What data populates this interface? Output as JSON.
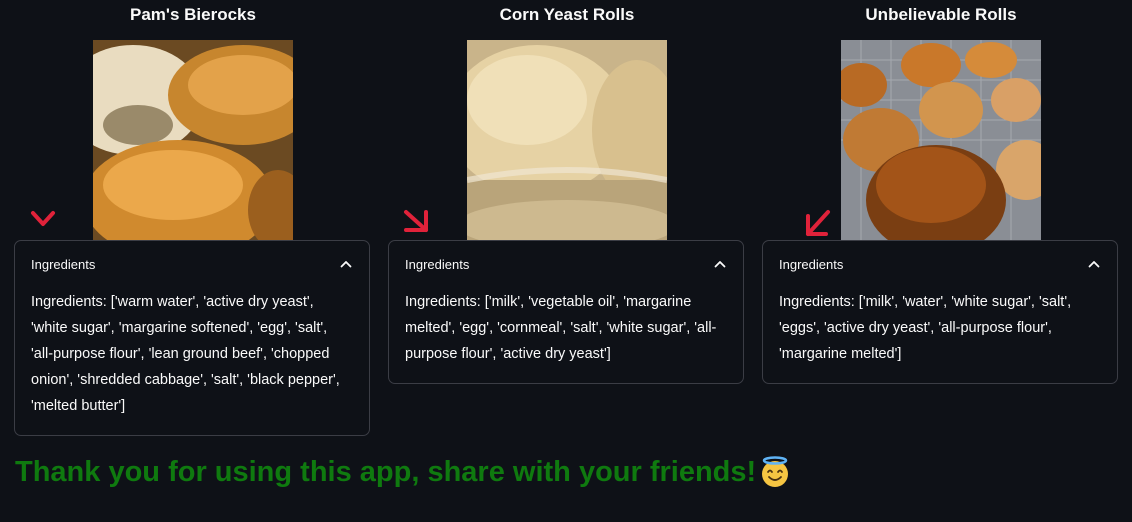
{
  "recipes": [
    {
      "title": "Pam's Bierocks",
      "expander_label": "Ingredients",
      "ingredients": "Ingredients: ['warm water', 'active dry yeast', 'white sugar', 'margarine softened', 'egg', 'salt', 'all-purpose flour', 'lean ground beef', 'chopped onion', 'shredded cabbage', 'salt', 'black pepper', 'melted butter']"
    },
    {
      "title": "Corn Yeast Rolls",
      "expander_label": "Ingredients",
      "ingredients": "Ingredients: ['milk', 'vegetable oil', 'margarine melted', 'egg', 'cornmeal', 'salt', 'white sugar', 'all-purpose flour', 'active dry yeast']"
    },
    {
      "title": "Unbelievable Rolls",
      "expander_label": "Ingredients",
      "ingredients": "Ingredients: ['milk', 'water', 'white sugar', 'salt', 'eggs', 'active dry yeast', 'all-purpose flour', 'margarine melted']"
    }
  ],
  "footer": {
    "message": "Thank you for using this app, share with your friends!",
    "emoji_icon": "smiling-face-with-halo-icon"
  },
  "colors": {
    "background": "#0e1117",
    "footer_text": "#0f7a0f",
    "annotation_arrow": "#e0223a",
    "border": "#3b3d45"
  }
}
